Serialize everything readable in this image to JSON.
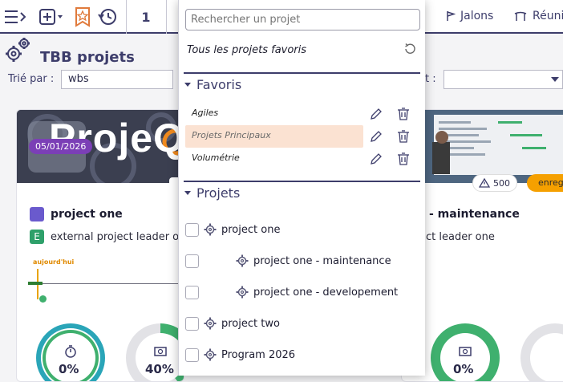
{
  "topbar": {
    "counter": "1",
    "nav_items": [
      "Jalons",
      "Réuni"
    ]
  },
  "page": {
    "title": "TBB projets",
    "sort_label": "Trié par :",
    "sort_value": "wbs",
    "filter_label_tail": "t :"
  },
  "cards": [
    {
      "date_badge": "05/01/2026",
      "banner_text": "ProjeQ",
      "name": "project one",
      "leader_initial": "E",
      "leader": "external project leader o",
      "today_label": "aujourd'hui",
      "gauges": [
        "0%",
        "40%"
      ]
    },
    {
      "name": "- maintenance",
      "leader": "ct leader one",
      "warning_count": "500",
      "status_badge": "enreg",
      "gauges": [
        "0%"
      ]
    }
  ],
  "dropdown": {
    "search_placeholder": "Rechercher un projet",
    "all_favorites": "Tous les projets favoris",
    "favorites_header": "Favoris",
    "favorites": [
      {
        "label": "Agiles"
      },
      {
        "label": "Projets Principaux"
      },
      {
        "label": "Volumétrie"
      }
    ],
    "projects_header": "Projets",
    "projects": [
      {
        "label": "project one"
      },
      {
        "label": "project one - maintenance"
      },
      {
        "label": "project one - developement"
      },
      {
        "label": "project two"
      },
      {
        "label": "Program 2026"
      }
    ]
  },
  "colors": {
    "brand": "#3d3d6b",
    "badge_purple": "#7b3fb6",
    "selected_row": "#fbe2d2",
    "gauge_teal": "#2aa5b8",
    "gauge_green": "#3fb06e",
    "orange": "#f5a000",
    "square_purple": "#6a5acd"
  }
}
